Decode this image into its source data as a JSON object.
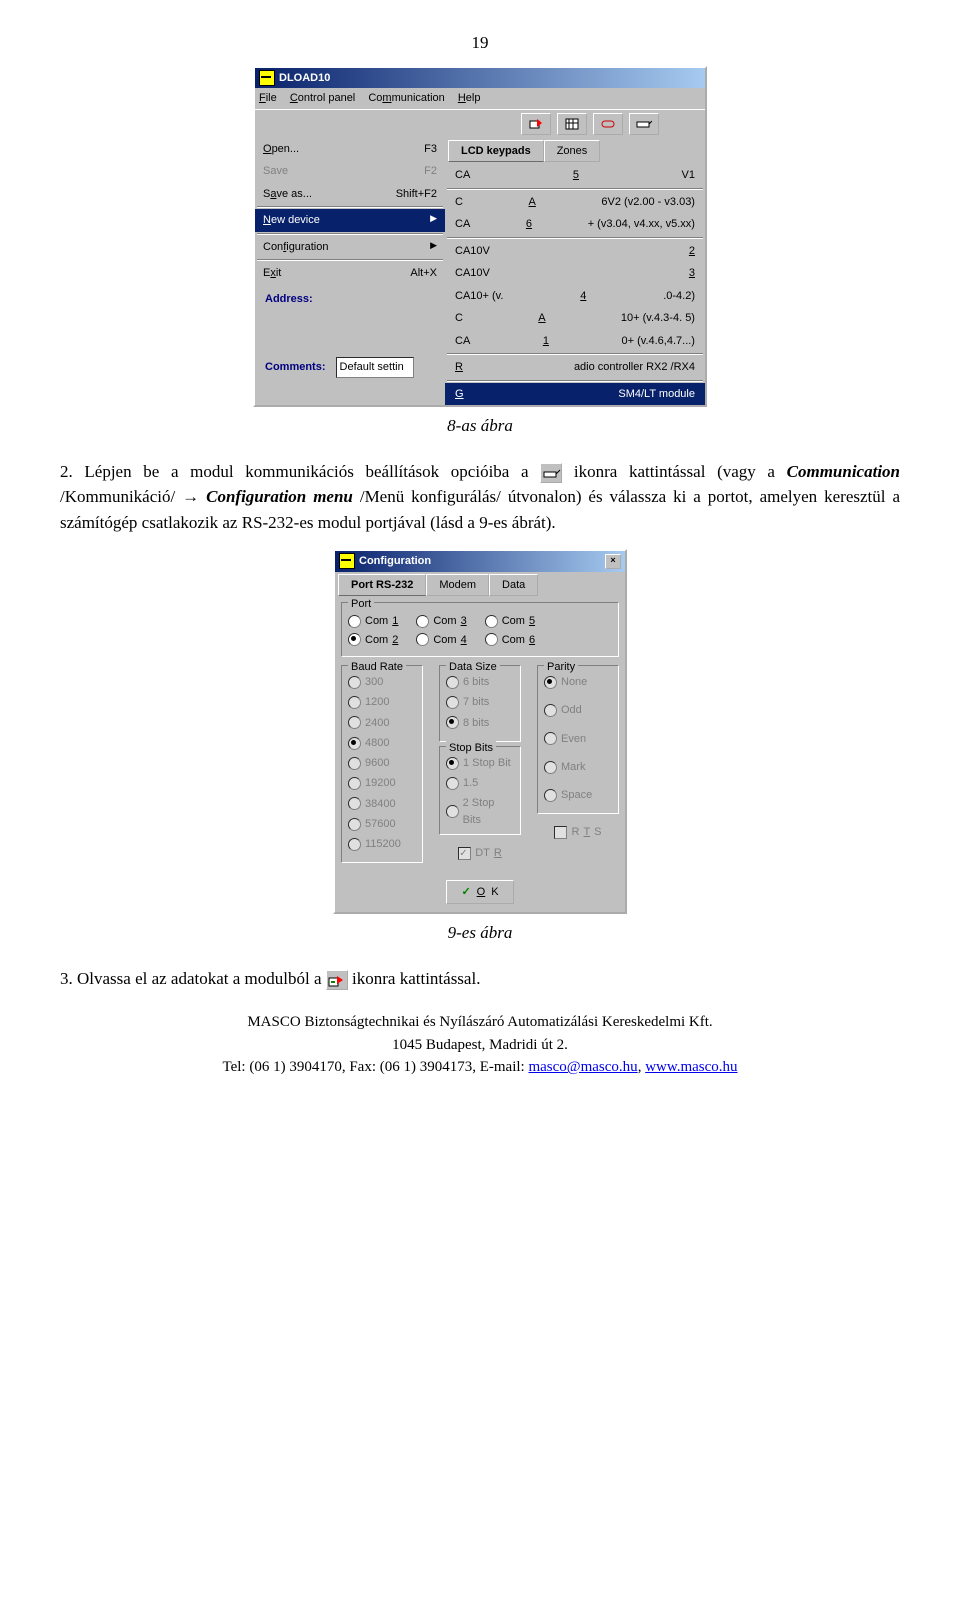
{
  "page_num": "19",
  "win1": {
    "title": "DLOAD10",
    "menu": [
      "File",
      "Control panel",
      "Communication",
      "Help"
    ],
    "file_menu": [
      {
        "label": "Open...",
        "shortcut": "F3",
        "disabled": false
      },
      {
        "label": "Save",
        "shortcut": "F2",
        "disabled": true
      },
      {
        "label": "Save as...",
        "shortcut": "Shift+F2",
        "disabled": false
      }
    ],
    "file_menu2": [
      {
        "label": "New device",
        "shortcut": "",
        "arrow": true,
        "hl": true
      },
      {
        "label": "Configuration",
        "shortcut": "",
        "arrow": true
      },
      {
        "label": "Exit",
        "shortcut": "Alt+X"
      }
    ],
    "tabs": [
      "LCD keypads",
      "Zones"
    ],
    "submenu": [
      "CA5V1",
      "CA6V2 (v2.00 - v3.03)",
      "CA6+ (v3.04, v4.xx, v5.xx)",
      "CA10V2",
      "CA10V3",
      "CA10+ (v.4.0-4.2)",
      "CA10+ (v.4.3-4. 5)",
      "CA10+ (v.4.6,4.7...)",
      "Radio controller RX2 /RX4",
      "GSM4/LT module"
    ],
    "left": {
      "address": "Address:",
      "comments": "Comments:",
      "comments_val": "Default settin"
    }
  },
  "caption1": "8-as ábra",
  "para1_a": "2. Lépjen be a modul kommunikációs beállítások opcióiba a ",
  "para1_b": " ikonra kattintással (vagy a ",
  "para1_c": "Communication",
  "para1_d": " /Kommunikáció/ → ",
  "para1_e": "Configuration menu",
  "para1_f": " /Menü konfigurálás/ útvonalon) és válassza ki a portot, amelyen keresztül a számítógép csatlakozik az RS-232-es modul portjával (lásd a 9-es ábrát).",
  "win2": {
    "title": "Configuration",
    "tabs": [
      "Port RS-232",
      "Modem",
      "Data"
    ],
    "port_group": "Port",
    "ports": [
      "Com 1",
      "Com 2",
      "Com 3",
      "Com 4",
      "Com 5",
      "Com 6"
    ],
    "baud_group": "Baud Rate",
    "bauds": [
      "300",
      "1200",
      "2400",
      "4800",
      "9600",
      "19200",
      "38400",
      "57600",
      "115200"
    ],
    "data_group": "Data Size",
    "datas": [
      "6 bits",
      "7 bits",
      "8 bits"
    ],
    "stop_group": "Stop Bits",
    "stops": [
      "1 Stop Bit",
      "1.5",
      "2 Stop Bits"
    ],
    "parity_group": "Parity",
    "parities": [
      "None",
      "Odd",
      "Even",
      "Mark",
      "Space"
    ],
    "dtr": "DTR",
    "rts": "RTS",
    "ok": "OK"
  },
  "caption2": "9-es ábra",
  "para2_a": "3. Olvassa el az adatokat a modulból a ",
  "para2_b": " ikonra kattintással.",
  "footer": {
    "l1": "MASCO Biztonságtechnikai és Nyílászáró Automatizálási Kereskedelmi Kft.",
    "l2": "1045 Budapest, Madridi út 2.",
    "l3a": "Tel: (06 1) 3904170, Fax: (06 1) 3904173, E-mail: ",
    "email": "masco@masco.hu",
    "l3b": ", ",
    "site": "www.masco.hu"
  }
}
